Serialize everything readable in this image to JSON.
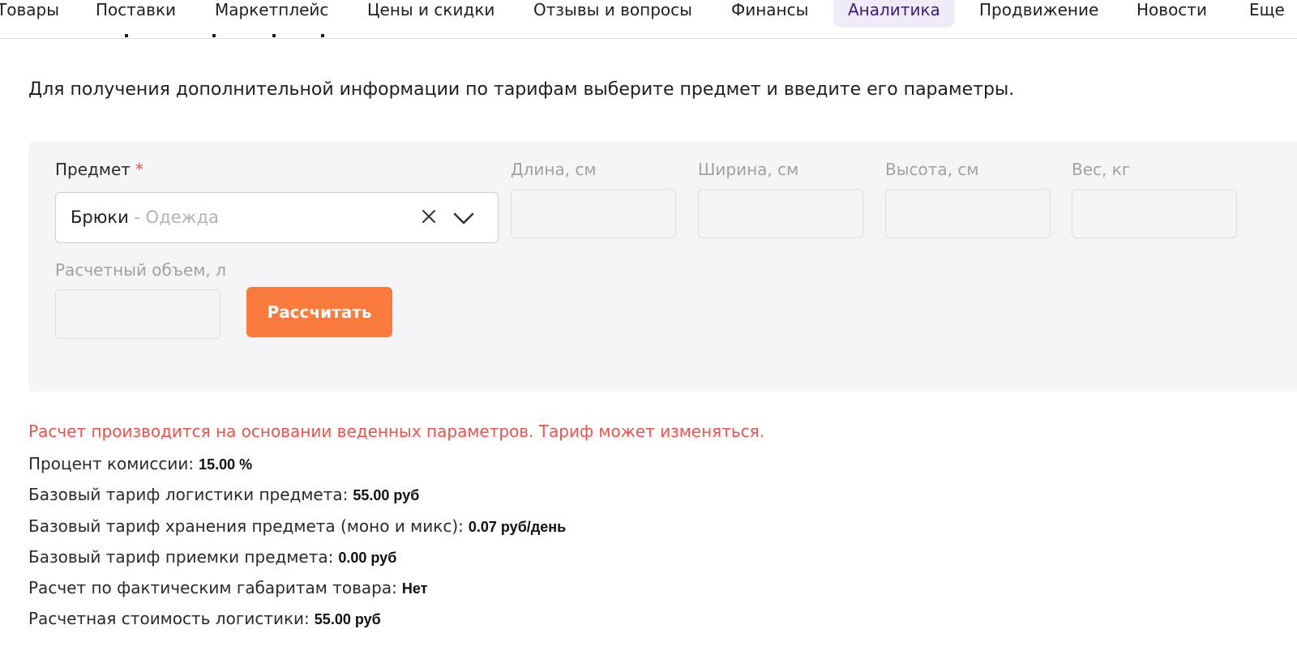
{
  "nav": {
    "items": [
      {
        "label": "Товары"
      },
      {
        "label": "Поставки"
      },
      {
        "label": "Маркетплейс"
      },
      {
        "label": "Цены и скидки"
      },
      {
        "label": "Отзывы и вопросы"
      },
      {
        "label": "Финансы"
      },
      {
        "label": "Аналитика"
      },
      {
        "label": "Продвижение"
      },
      {
        "label": "Новости"
      },
      {
        "label": "Еще"
      }
    ],
    "active": "Аналитика"
  },
  "intro": "Для получения дополнительной информации по тарифам выберите предмет и введите его параметры.",
  "form": {
    "subject": {
      "label": "Предмет",
      "required_mark": "*",
      "value": "Брюки",
      "category": " - Одежда"
    },
    "length": {
      "label": "Длина, см",
      "value": ""
    },
    "width": {
      "label": "Ширина, см",
      "value": ""
    },
    "height": {
      "label": "Высота, см",
      "value": ""
    },
    "weight": {
      "label": "Вес, кг",
      "value": ""
    },
    "volume": {
      "label": "Расчетный объем, л",
      "value": ""
    },
    "calculate_button": "Рассчитать"
  },
  "warning": "Расчет производится на основании веденных параметров. Тариф может изменяться.",
  "results": [
    {
      "label": "Процент комиссии:",
      "value": "15.00 %"
    },
    {
      "label": "Базовый тариф логистики предмета:",
      "value": "55.00 руб"
    },
    {
      "label": "Базовый тариф хранения предмета (моно и микс):",
      "value": "0.07 руб/день"
    },
    {
      "label": "Базовый тариф приемки предмета:",
      "value": "0.00 руб"
    },
    {
      "label": "Расчет по фактическим габаритам товара:",
      "value": "Нет"
    },
    {
      "label": "Расчетная стоимость логистики:",
      "value": "55.00 руб"
    }
  ],
  "colors": {
    "accent_button": "#fb7a3e",
    "warning": "#f0514b",
    "active_tab_bg": "#efebf9",
    "active_tab_text": "#3a1c78",
    "panel_bg": "#f5f5f7"
  }
}
